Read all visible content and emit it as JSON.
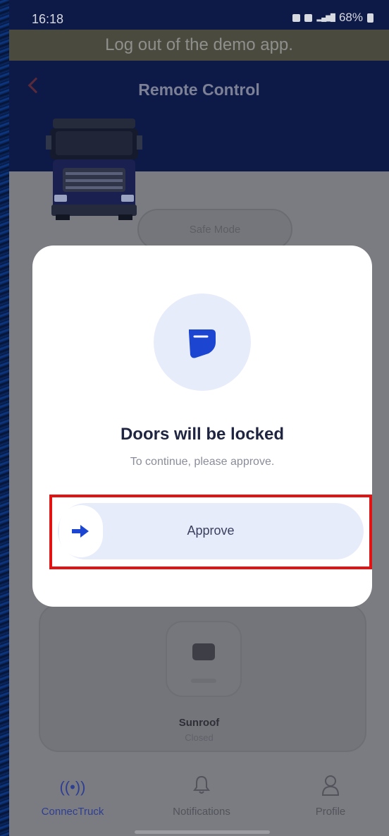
{
  "status_bar": {
    "time": "16:18",
    "battery": "68%"
  },
  "demo_banner": "Log out of the demo app.",
  "header": {
    "title": "Remote Control"
  },
  "safe_mode": {
    "label": "Safe Mode"
  },
  "modal": {
    "title": "Doors will be locked",
    "subtitle": "To continue, please approve.",
    "approve_label": "Approve"
  },
  "background_control": {
    "label": "Sunroof",
    "status": "Closed"
  },
  "bottom_nav": {
    "items": [
      {
        "label": "ConnecTruck",
        "icon": "connectivity-icon",
        "active": true
      },
      {
        "label": "Notifications",
        "icon": "bell-icon",
        "active": false
      },
      {
        "label": "Profile",
        "icon": "person-icon",
        "active": false
      }
    ]
  },
  "colors": {
    "accent": "#1c46d1",
    "header_bg": "#0d1a47",
    "highlight": "#e21313",
    "modal_bg": "#ffffff",
    "overlay": "#7b7c82"
  }
}
